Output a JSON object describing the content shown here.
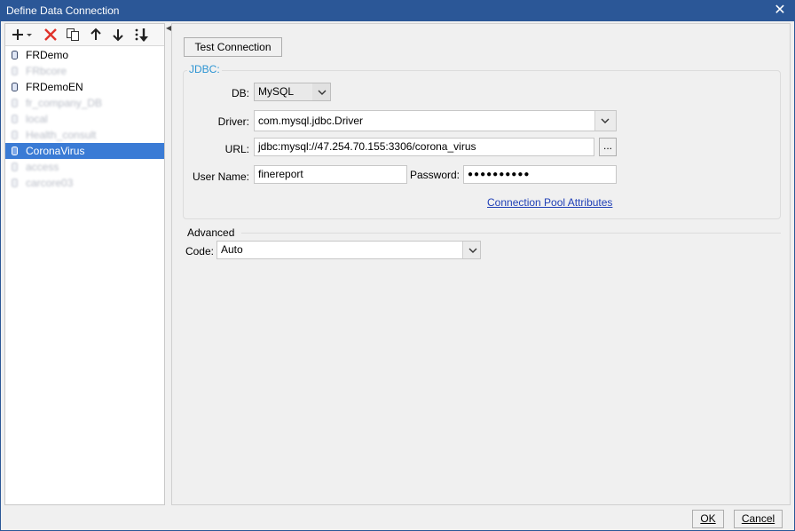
{
  "window": {
    "title": "Define Data Connection"
  },
  "toolbar": {
    "add_icon": "plus-icon",
    "delete_icon": "delete-x-icon",
    "copy_icon": "copy-icon",
    "up_icon": "arrow-up-icon",
    "down_icon": "arrow-down-icon",
    "sort_icon": "sort-icon"
  },
  "connections": [
    {
      "label": "FRDemo",
      "blurred": false,
      "selected": false
    },
    {
      "label": "FRbcore",
      "blurred": true,
      "selected": false
    },
    {
      "label": "FRDemoEN",
      "blurred": false,
      "selected": false
    },
    {
      "label": "fr_company_DB",
      "blurred": true,
      "selected": false
    },
    {
      "label": "local",
      "blurred": true,
      "selected": false
    },
    {
      "label": "Health_consult",
      "blurred": true,
      "selected": false
    },
    {
      "label": "CoronaVirus",
      "blurred": false,
      "selected": true
    },
    {
      "label": "access",
      "blurred": true,
      "selected": false
    },
    {
      "label": "carcore03",
      "blurred": true,
      "selected": false
    }
  ],
  "form": {
    "test_connection": "Test Connection",
    "group_label": "JDBC:",
    "db_label": "DB:",
    "db_value": "MySQL",
    "driver_label": "Driver:",
    "driver_value": "com.mysql.jdbc.Driver",
    "url_label": "URL:",
    "url_value": "jdbc:mysql://47.254.70.155:3306/corona_virus",
    "browse_label": "...",
    "username_label": "User Name:",
    "username_value": "finereport",
    "password_label": "Password:",
    "password_value": "●●●●●●●●●●",
    "pool_link": "Connection Pool Attributes",
    "advanced_label": "Advanced",
    "code_label": "Code:",
    "code_value": "Auto"
  },
  "footer": {
    "ok": "OK",
    "cancel": "Cancel"
  },
  "colors": {
    "titlebar": "#2b5797",
    "selection": "#3a7bd5",
    "group_label": "#2e95d3",
    "link": "#1f3fb6"
  }
}
